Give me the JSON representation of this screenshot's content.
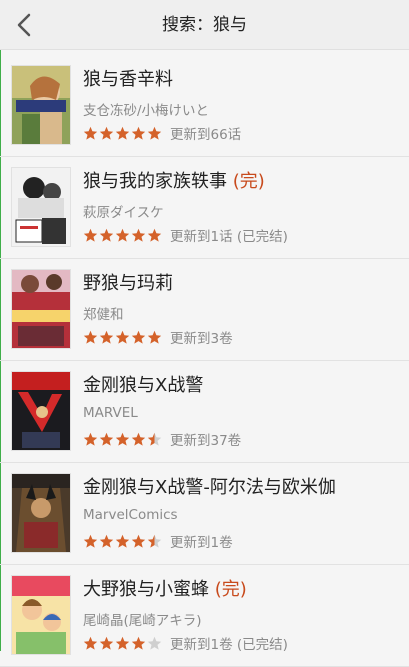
{
  "header": {
    "title": "搜索：狼与",
    "back_icon": "chevron-left-icon"
  },
  "colors": {
    "accent": "#3fae49",
    "star": "#d4622a",
    "star_empty": "#cfcfcf",
    "done_tag": "#c84a1c"
  },
  "results": [
    {
      "title": "狼与香辛料",
      "done": "",
      "author": "支仓冻砂/小梅けいと",
      "rating": 5,
      "update": "更新到66话",
      "cover": "cover-1"
    },
    {
      "title": "狼与我的家族轶事",
      "done": "(完)",
      "author": "萩原ダイスケ",
      "rating": 5,
      "update": "更新到1话 (已完结)",
      "cover": "cover-2"
    },
    {
      "title": "野狼与玛莉",
      "done": "",
      "author": "郑健和",
      "rating": 5,
      "update": "更新到3卷",
      "cover": "cover-3"
    },
    {
      "title": "金刚狼与X战警",
      "done": "",
      "author": "MARVEL",
      "rating": 4.5,
      "update": "更新到37卷",
      "cover": "cover-4"
    },
    {
      "title": "金刚狼与X战警-阿尔法与欧米伽",
      "done": "",
      "author": "MarvelComics",
      "rating": 4.5,
      "update": "更新到1卷",
      "cover": "cover-5"
    },
    {
      "title": "大野狼与小蜜蜂",
      "done": "(完)",
      "author": "尾崎晶(尾崎アキラ)",
      "rating": 4,
      "update": "更新到1卷 (已完结)",
      "cover": "cover-6"
    }
  ]
}
